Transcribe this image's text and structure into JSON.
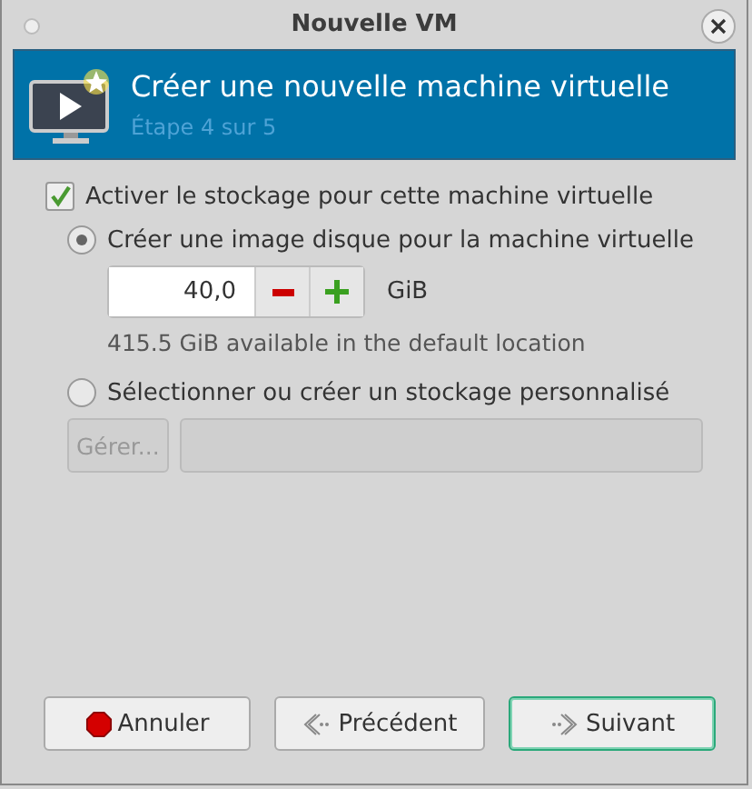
{
  "window": {
    "title": "Nouvelle VM"
  },
  "banner": {
    "title": "Créer une nouvelle machine virtuelle",
    "subtitle": "Étape 4 sur 5"
  },
  "storage": {
    "label": "Activer le stockage pour cette machine virtuelle",
    "checked": true
  },
  "options": [
    {
      "kind": "create",
      "label": "Créer une image disque pour la machine virtuelle",
      "selected": true,
      "size": "40,0",
      "unit": "GiB",
      "note": "415.5 GiB available in the default location"
    },
    {
      "kind": "custom",
      "label": "Sélectionner ou créer un stockage personnalisé",
      "selected": false,
      "button": {
        "label": "Gérer...",
        "disabled": true
      },
      "path_disabled": true
    }
  ],
  "buttons": [
    {
      "kind": "cancel",
      "label": "Annuler",
      "focused": false
    },
    {
      "kind": "back",
      "label": "Précédent",
      "focused": false
    },
    {
      "kind": "next",
      "label": "Suivant",
      "focused": true
    }
  ]
}
